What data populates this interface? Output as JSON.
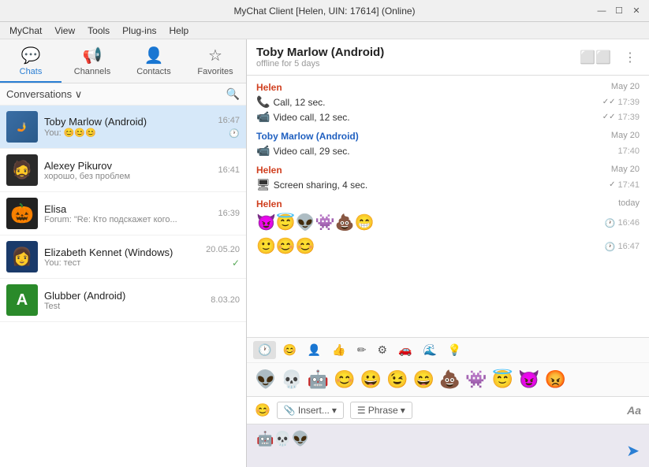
{
  "titlebar": {
    "title": "MyChat Client [Helen, UIN: 17614] (Online)",
    "minimize": "—",
    "maximize": "☐",
    "close": "✕"
  },
  "menubar": {
    "items": [
      "MyChat",
      "View",
      "Tools",
      "Plug-ins",
      "Help"
    ]
  },
  "nav": {
    "tabs": [
      {
        "id": "chats",
        "label": "Chats",
        "icon": "💬",
        "active": true
      },
      {
        "id": "channels",
        "label": "Channels",
        "icon": "📢",
        "active": false
      },
      {
        "id": "contacts",
        "label": "Contacts",
        "icon": "👤",
        "active": false
      },
      {
        "id": "favorites",
        "label": "Favorites",
        "icon": "☆",
        "active": false
      }
    ]
  },
  "sidebar": {
    "header": "Conversations ∨",
    "conversations": [
      {
        "id": 1,
        "name": "Toby Marlow (Android)",
        "preview": "You: 😊😊😊",
        "time": "16:47",
        "active": true,
        "avatar_bg": "blue",
        "avatar_icon": "👤",
        "status_icon": "🕐"
      },
      {
        "id": 2,
        "name": "Alexey Pikurov",
        "preview": "хорошо, без проблем",
        "time": "16:41",
        "active": false,
        "avatar_bg": "dark",
        "avatar_icon": "👤",
        "status_icon": ""
      },
      {
        "id": 3,
        "name": "Elisa",
        "preview": "Forum: \"Re: Кто подскажет кого...",
        "time": "16:39",
        "active": false,
        "avatar_bg": "teal",
        "avatar_icon": "🎃",
        "status_icon": ""
      },
      {
        "id": 4,
        "name": "Elizabeth Kennet (Windows)",
        "preview": "You: тест",
        "time": "20.05.20",
        "active": false,
        "avatar_bg": "darkblue",
        "avatar_icon": "👤",
        "status_icon": "✓"
      },
      {
        "id": 5,
        "name": "Glubber (Android)",
        "preview": "Test",
        "time": "8.03.20",
        "active": false,
        "avatar_bg": "green",
        "avatar_icon": "A",
        "status_icon": ""
      }
    ]
  },
  "chat": {
    "name": "Toby Marlow (Android)",
    "status": "offline for 5 days",
    "messages": [
      {
        "sender": "Helen",
        "sender_class": "helen",
        "date": "May 20",
        "rows": [
          {
            "icon": "📞",
            "text": "Call, 12 sec.",
            "time": "17:39",
            "check": "✓✓"
          },
          {
            "icon": "📹",
            "text": "Video call, 12 sec.",
            "time": "17:39",
            "check": "✓✓"
          }
        ]
      },
      {
        "sender": "Toby Marlow (Android)",
        "sender_class": "toby",
        "date": "May 20",
        "rows": [
          {
            "icon": "📹",
            "text": "Video call, 29 sec.",
            "time": "17:40",
            "check": ""
          }
        ]
      },
      {
        "sender": "Helen",
        "sender_class": "helen",
        "date": "May 20",
        "rows": [
          {
            "icon": "🖥",
            "text": "Screen sharing, 4 sec.",
            "time": "17:41",
            "check": "✓"
          }
        ]
      },
      {
        "sender": "Helen",
        "sender_class": "helen",
        "date": "today",
        "rows": [],
        "emoji_rows": [
          {
            "emojis": "😈😇👽👾💩😁",
            "time": "16:46",
            "check": ""
          },
          {
            "emojis": "🙂😊😊",
            "time": "16:47",
            "check": ""
          }
        ]
      }
    ]
  },
  "emoji_picker": {
    "tabs": [
      "🕐",
      "😊",
      "👤",
      "👍",
      "✏",
      "⚙",
      "🚗",
      "🌊",
      "💡"
    ],
    "active_tab": 0,
    "emojis": [
      "👽",
      "💀",
      "🤖",
      "😊",
      "😀",
      "😉",
      "😄",
      "💩",
      "👾",
      "😇",
      "😈",
      "😡"
    ]
  },
  "input_bar": {
    "emoji_btn": "😊",
    "attach_icon": "📎",
    "insert_label": "Insert...",
    "insert_arrow": "▾",
    "phrase_icon": "☰",
    "phrase_label": "Phrase",
    "phrase_arrow": "▾",
    "aa_label": "Aa"
  },
  "text_input": {
    "content": "🤖💀👽",
    "send_icon": "➤"
  }
}
